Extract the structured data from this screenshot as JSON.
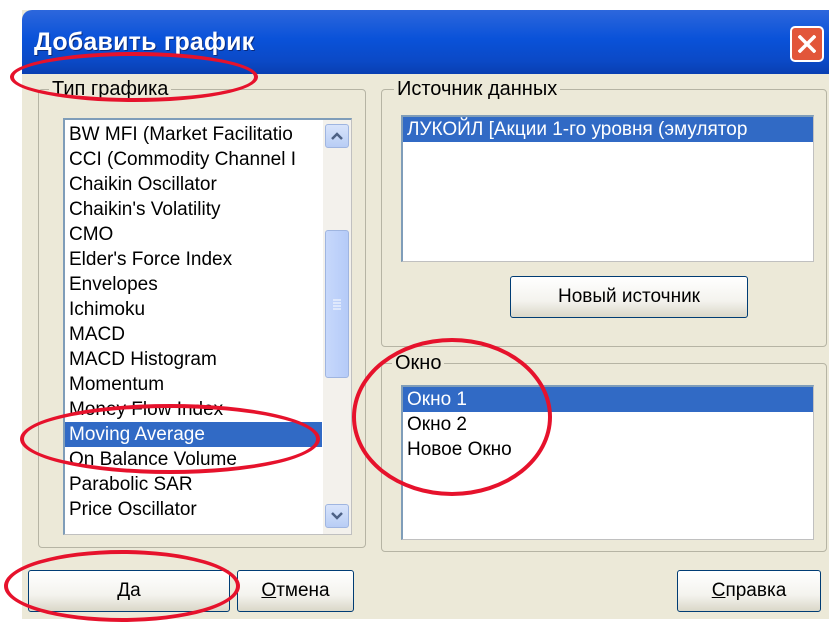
{
  "dialog": {
    "title": "Добавить график"
  },
  "chart_type": {
    "label": "Тип графика",
    "items": [
      "BW MFI (Market Facilitatio",
      "CCI (Commodity Channel I",
      "Chaikin Oscillator",
      "Chaikin's Volatility",
      "CMO",
      "Elder's Force Index",
      "Envelopes",
      "Ichimoku",
      "MACD",
      "MACD Histogram",
      "Momentum",
      "Money Flow Index",
      "Moving Average",
      "On Balance Volume",
      "Parabolic SAR",
      "Price Oscillator"
    ],
    "selected": "Moving Average"
  },
  "data_source": {
    "label": "Источник данных",
    "items": [
      "ЛУКОЙЛ [Акции 1-го уровня (эмулятор"
    ],
    "new_button": "Новый источник"
  },
  "window_group": {
    "label": "Окно",
    "items": [
      "Окно 1",
      "Окно 2",
      "Новое Окно"
    ],
    "selected": "Окно 1"
  },
  "buttons": {
    "ok": {
      "underlined": "Д",
      "rest": "а"
    },
    "cancel": {
      "underlined": "О",
      "rest": "тмена"
    },
    "help": {
      "underlined": "С",
      "rest": "правка"
    }
  },
  "colors": {
    "titlebar": "#0a52d9",
    "selection": "#316ac5",
    "annotation": "#e6122c",
    "dialog_bg": "#ece9d8"
  },
  "icons": {
    "close": "close-x-icon",
    "scroll_up": "scroll-up-arrow-icon",
    "scroll_down": "scroll-down-arrow-icon",
    "scroll_grip": "scroll-grip-icon"
  }
}
